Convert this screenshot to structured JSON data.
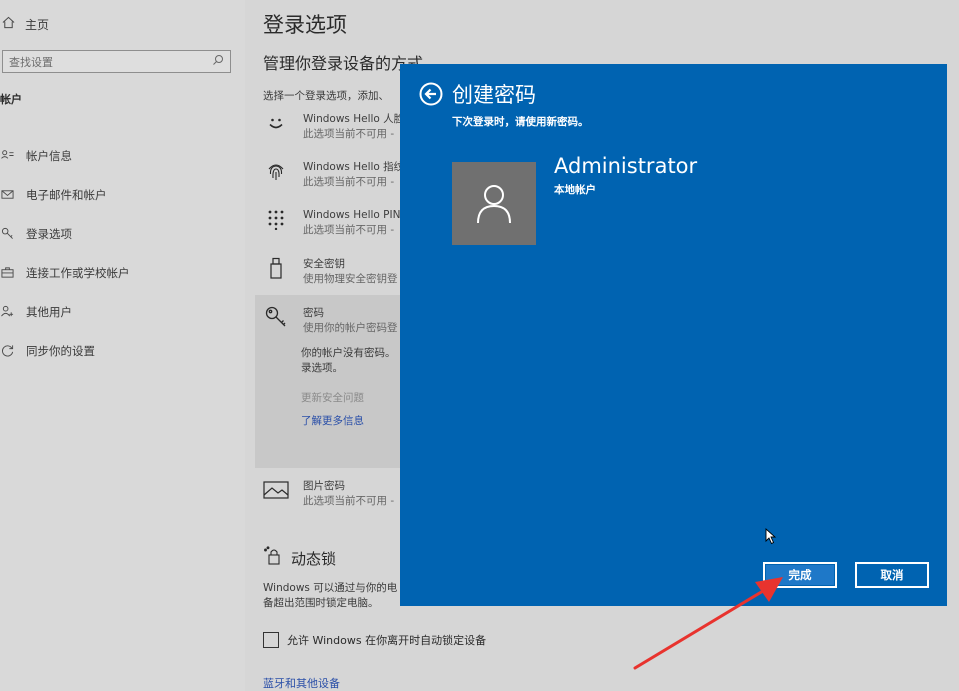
{
  "sidebar": {
    "home_label": "主页",
    "search_placeholder": "查找设置",
    "section_label": "帐户",
    "items": [
      {
        "label": "帐户信息",
        "icon": "account-info-icon"
      },
      {
        "label": "电子邮件和帐户",
        "icon": "mail-icon"
      },
      {
        "label": "登录选项",
        "icon": "key-icon"
      },
      {
        "label": "连接工作或学校帐户",
        "icon": "briefcase-icon"
      },
      {
        "label": "其他用户",
        "icon": "person-add-icon"
      },
      {
        "label": "同步你的设置",
        "icon": "sync-icon"
      }
    ]
  },
  "main": {
    "title": "登录选项",
    "subtitle": "管理你登录设备的方式",
    "description": "选择一个登录选项，添加、",
    "options": [
      {
        "name": "Windows Hello 人脸",
        "status": "此选项当前不可用 -",
        "icon": "face-icon"
      },
      {
        "name": "Windows Hello 指纹",
        "status": "此选项当前不可用 -",
        "icon": "fingerprint-icon"
      },
      {
        "name": "Windows Hello PIN",
        "status": "此选项当前不可用 -",
        "icon": "pin-keypad-icon"
      },
      {
        "name": "安全密钥",
        "status": "使用物理安全密钥登",
        "icon": "usb-key-icon"
      },
      {
        "name": "密码",
        "status": "使用你的帐户密码登",
        "icon": "password-key-icon"
      },
      {
        "name": "图片密码",
        "status": "此选项当前不可用 -",
        "icon": "picture-icon"
      }
    ],
    "password_note_line1": "你的帐户没有密码。",
    "password_note_line2": "录选项。",
    "change_security_questions": "更新安全问题",
    "learn_more": "了解更多信息",
    "dynamic_lock_title": "动态锁",
    "dynamic_lock_desc_line1": "Windows 可以通过与你的电",
    "dynamic_lock_desc_line2": "备超出范围时锁定电脑。",
    "dynamic_lock_checkbox": "允许 Windows 在你离开时自动锁定设备",
    "bluetooth_link": "蓝牙和其他设备"
  },
  "dialog": {
    "title": "创建密码",
    "subtitle": "下次登录时，请使用新密码。",
    "account_name": "Administrator",
    "account_type": "本地帐户",
    "finish_label": "完成",
    "cancel_label": "取消",
    "background_color": "#0063b1"
  },
  "annotation": {
    "arrow_color": "#e8332e"
  }
}
